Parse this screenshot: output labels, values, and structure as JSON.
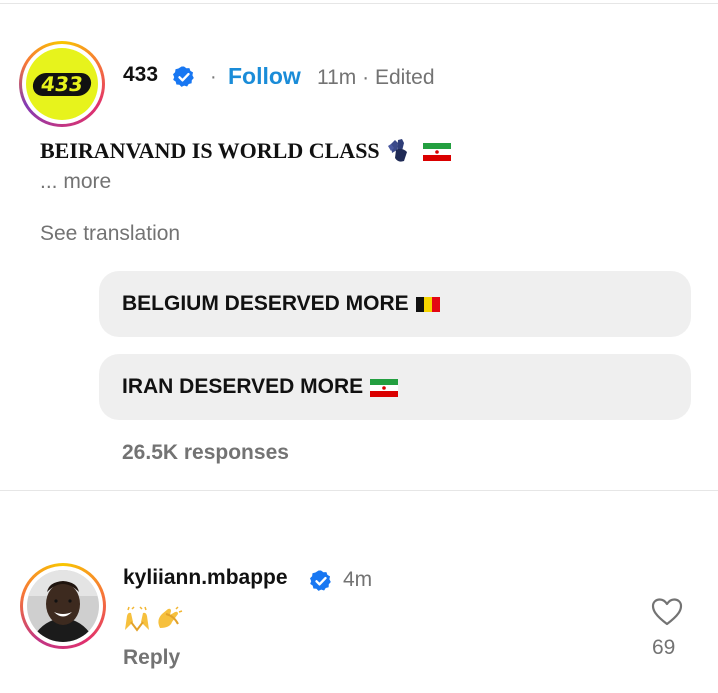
{
  "post": {
    "avatar_logo_text": "433",
    "username": "433",
    "separator": "·",
    "follow_label": "Follow",
    "meta": "11m · Edited",
    "caption": "BEIRANVAND IS WORLD CLASS",
    "caption_icons": [
      "gloves-icon",
      "iran-flag-icon"
    ],
    "more_label": "... more",
    "see_translation_label": "See translation",
    "poll": {
      "options": [
        {
          "label": "BELGIUM DESERVED MORE",
          "icon": "belgium-flag-icon"
        },
        {
          "label": "IRAN DESERVED MORE",
          "icon": "iran-flag-icon"
        }
      ],
      "responses": "26.5K responses"
    }
  },
  "comment": {
    "username": "kyliiann.mbappe",
    "time": "4m",
    "emoji_icons": [
      "raising-hands-icon",
      "clapping-hands-icon"
    ],
    "reply_label": "Reply",
    "like_count": "69"
  },
  "colors": {
    "follow": "#1a8cd8",
    "verified": "#1877f2",
    "muted": "#737373",
    "poll_bg": "#efefef",
    "logo_yellow": "#e7f31c"
  }
}
